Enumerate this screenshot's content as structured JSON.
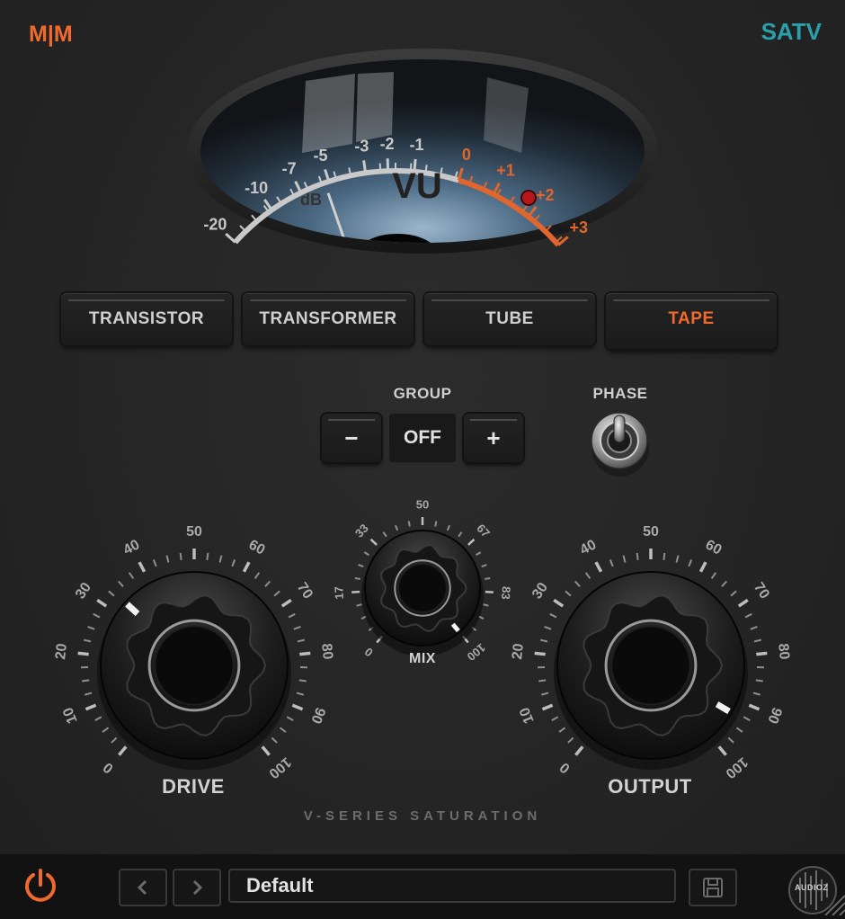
{
  "brand": {
    "logo": "M|M",
    "product": "SATV"
  },
  "vu_meter": {
    "title": "VU",
    "unit": "dB",
    "scale_labels": [
      "-20",
      "-10",
      "-7",
      "-5",
      "-3",
      "-2",
      "-1",
      "0",
      "+1",
      "+2",
      "+3"
    ],
    "needle_db": -5.3,
    "colors": {
      "normal": "#c9c9c9",
      "overload": "#e0662d",
      "peak_led": "#b8161c"
    }
  },
  "modes": {
    "items": [
      "TRANSISTOR",
      "TRANSFORMER",
      "TUBE",
      "TAPE"
    ],
    "selected": "TAPE"
  },
  "group": {
    "label": "GROUP",
    "minus": "−",
    "value": "OFF",
    "plus": "+"
  },
  "phase": {
    "label": "PHASE",
    "state": "off"
  },
  "knobs": {
    "drive": {
      "label": "DRIVE",
      "scale": [
        "0",
        "10",
        "20",
        "30",
        "40",
        "50",
        "60",
        "70",
        "80",
        "90",
        "100"
      ],
      "value": 33
    },
    "mix": {
      "label": "MIX",
      "scale": [
        "0",
        "17",
        "33",
        "50",
        "67",
        "83",
        "100"
      ],
      "value": 100
    },
    "output": {
      "label": "OUTPUT",
      "scale": [
        "0",
        "10",
        "20",
        "30",
        "40",
        "50",
        "60",
        "70",
        "80",
        "90",
        "100"
      ],
      "value": 93
    }
  },
  "tagline": "V-SERIES SATURATION",
  "footer": {
    "power_icon": "power-icon",
    "prev": "‹",
    "next": "›",
    "preset": "Default",
    "save_icon": "floppy-disk-icon",
    "watermark": "AUDIOZ"
  },
  "colors": {
    "accent": "#f06a2d",
    "product": "#2aa0ad"
  }
}
